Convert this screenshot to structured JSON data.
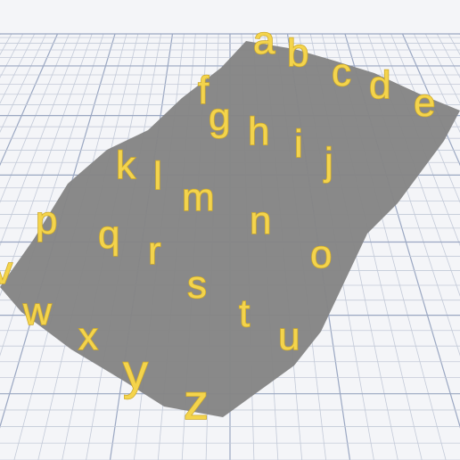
{
  "scene": {
    "plate_color": "#f4f5f8",
    "grid_color": "#c3cad8",
    "grid_major_color": "#9aa7c2",
    "shape_color": "#858585",
    "glyph_color": "#f4d44c"
  },
  "letters": [
    "a",
    "b",
    "c",
    "d",
    "e",
    "f",
    "g",
    "h",
    "i",
    "j",
    "k",
    "l",
    "m",
    "n",
    "o",
    "p",
    "q",
    "r",
    "s",
    "t",
    "u",
    "v",
    "w",
    "x",
    "y",
    "z"
  ]
}
